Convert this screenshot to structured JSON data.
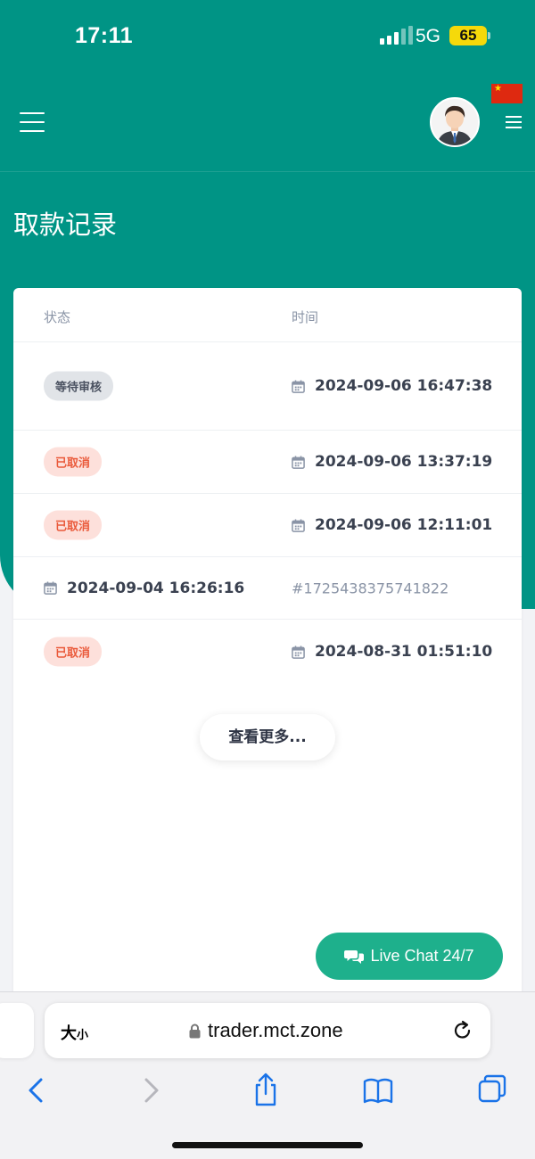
{
  "status_bar": {
    "time": "17:11",
    "network": "5G",
    "battery": "65"
  },
  "header": {
    "avatar_alt": "user avatar"
  },
  "page": {
    "title": "取款记录"
  },
  "table": {
    "headers": {
      "status": "状态",
      "time": "时间"
    },
    "rows": [
      {
        "status": "等待审核",
        "status_type": "pending",
        "time": "2024-09-06 16:47:38"
      },
      {
        "status": "已取消",
        "status_type": "cancelled",
        "time": "2024-09-06 13:37:19"
      },
      {
        "status": "已取消",
        "status_type": "cancelled",
        "time": "2024-09-06 12:11:01"
      },
      {
        "time": "2024-09-04 16:26:16",
        "reference": "#1725438375741822"
      },
      {
        "status": "已取消",
        "status_type": "cancelled",
        "time": "2024-08-31 01:51:10"
      }
    ]
  },
  "load_more_label": "查看更多...",
  "live_chat_label": "Live Chat 24/7",
  "browser": {
    "text_size_label_big": "大",
    "text_size_label_small": "小",
    "url": "trader.mct.zone"
  },
  "colors": {
    "brand_teal": "#009485",
    "live_chat_green": "#1eb08c",
    "pending_badge_bg": "#e1e4e8",
    "cancel_badge_bg": "#fde0db",
    "cancel_badge_text": "#ea5a3b"
  }
}
